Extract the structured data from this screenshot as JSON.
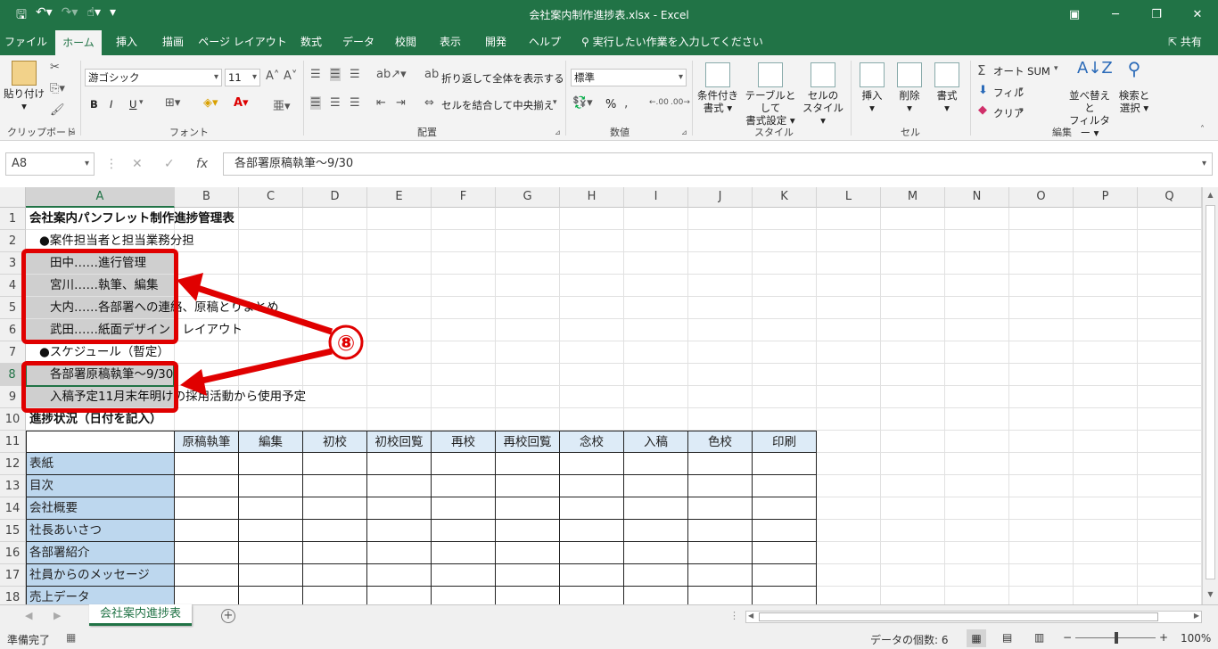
{
  "window": {
    "title": "会社案内制作進捗表.xlsx  -  Excel"
  },
  "menu": {
    "tabs": [
      "ファイル",
      "ホーム",
      "挿入",
      "描画",
      "ページ レイアウト",
      "数式",
      "データ",
      "校閲",
      "表示",
      "開発",
      "ヘルプ"
    ],
    "active": "ホーム",
    "tell_me": "実行したい作業を入力してください",
    "share": "共有"
  },
  "ribbon": {
    "clipboard": {
      "label": "クリップボード",
      "paste": "貼り付け"
    },
    "font": {
      "label": "フォント",
      "family": "游ゴシック",
      "size": "11",
      "bold": "B",
      "italic": "I",
      "underline": "U"
    },
    "alignment": {
      "label": "配置",
      "wrap": "折り返して全体を表示する",
      "merge": "セルを結合して中央揃え"
    },
    "number": {
      "label": "数値",
      "format": "標準",
      "percent": "%"
    },
    "styles": {
      "label": "スタイル",
      "conditional": [
        "条件付き",
        "書式"
      ],
      "table": [
        "テーブルとして",
        "書式設定"
      ],
      "cell": [
        "セルの",
        "スタイル"
      ]
    },
    "cells": {
      "label": "セル",
      "insert": "挿入",
      "delete": "削除",
      "format": "書式"
    },
    "editing": {
      "label": "編集",
      "autosum": "オート SUM",
      "fill": "フィル",
      "clear": "クリア",
      "sort": [
        "並べ替えと",
        "フィルター"
      ],
      "find": [
        "検索と",
        "選択"
      ]
    }
  },
  "formula_bar": {
    "name_box": "A8",
    "formula": "各部署原稿執筆～9/30"
  },
  "columns": [
    "A",
    "B",
    "C",
    "D",
    "E",
    "F",
    "G",
    "H",
    "I",
    "J",
    "K",
    "L",
    "M",
    "N",
    "O",
    "P",
    "Q"
  ],
  "rows": [
    "1",
    "2",
    "3",
    "4",
    "5",
    "6",
    "7",
    "8",
    "9",
    "10",
    "11",
    "12",
    "13",
    "14",
    "15",
    "16",
    "17",
    "18"
  ],
  "cells": {
    "r1": "会社案内パンフレット制作進捗管理表",
    "r2": "●案件担当者と担当業務分担",
    "r3": "田中……進行管理",
    "r4": "宮川……執筆、編集",
    "r5": "大内……各部署への連絡、原稿とりまとめ",
    "r6": "武田……紙面デザイン・レイアウト",
    "r7": "●スケジュール（暫定）",
    "r8": "各部署原稿執筆～9/30",
    "r9": "入稿予定11月末年明けの採用活動から使用予定",
    "r10": "進捗状況（日付を記入）"
  },
  "table": {
    "headers": [
      "原稿執筆",
      "編集",
      "初校",
      "初校回覧",
      "再校",
      "再校回覧",
      "念校",
      "入稿",
      "色校",
      "印刷"
    ],
    "items": [
      "表紙",
      "目次",
      "会社概要",
      "社長あいさつ",
      "各部署紹介",
      "社員からのメッセージ",
      "売上データ"
    ]
  },
  "annotation": {
    "number": "⑧"
  },
  "sheets": {
    "active": "会社案内進捗表"
  },
  "status": {
    "ready": "準備完了",
    "count": "データの個数: 6",
    "zoom": "100%"
  }
}
